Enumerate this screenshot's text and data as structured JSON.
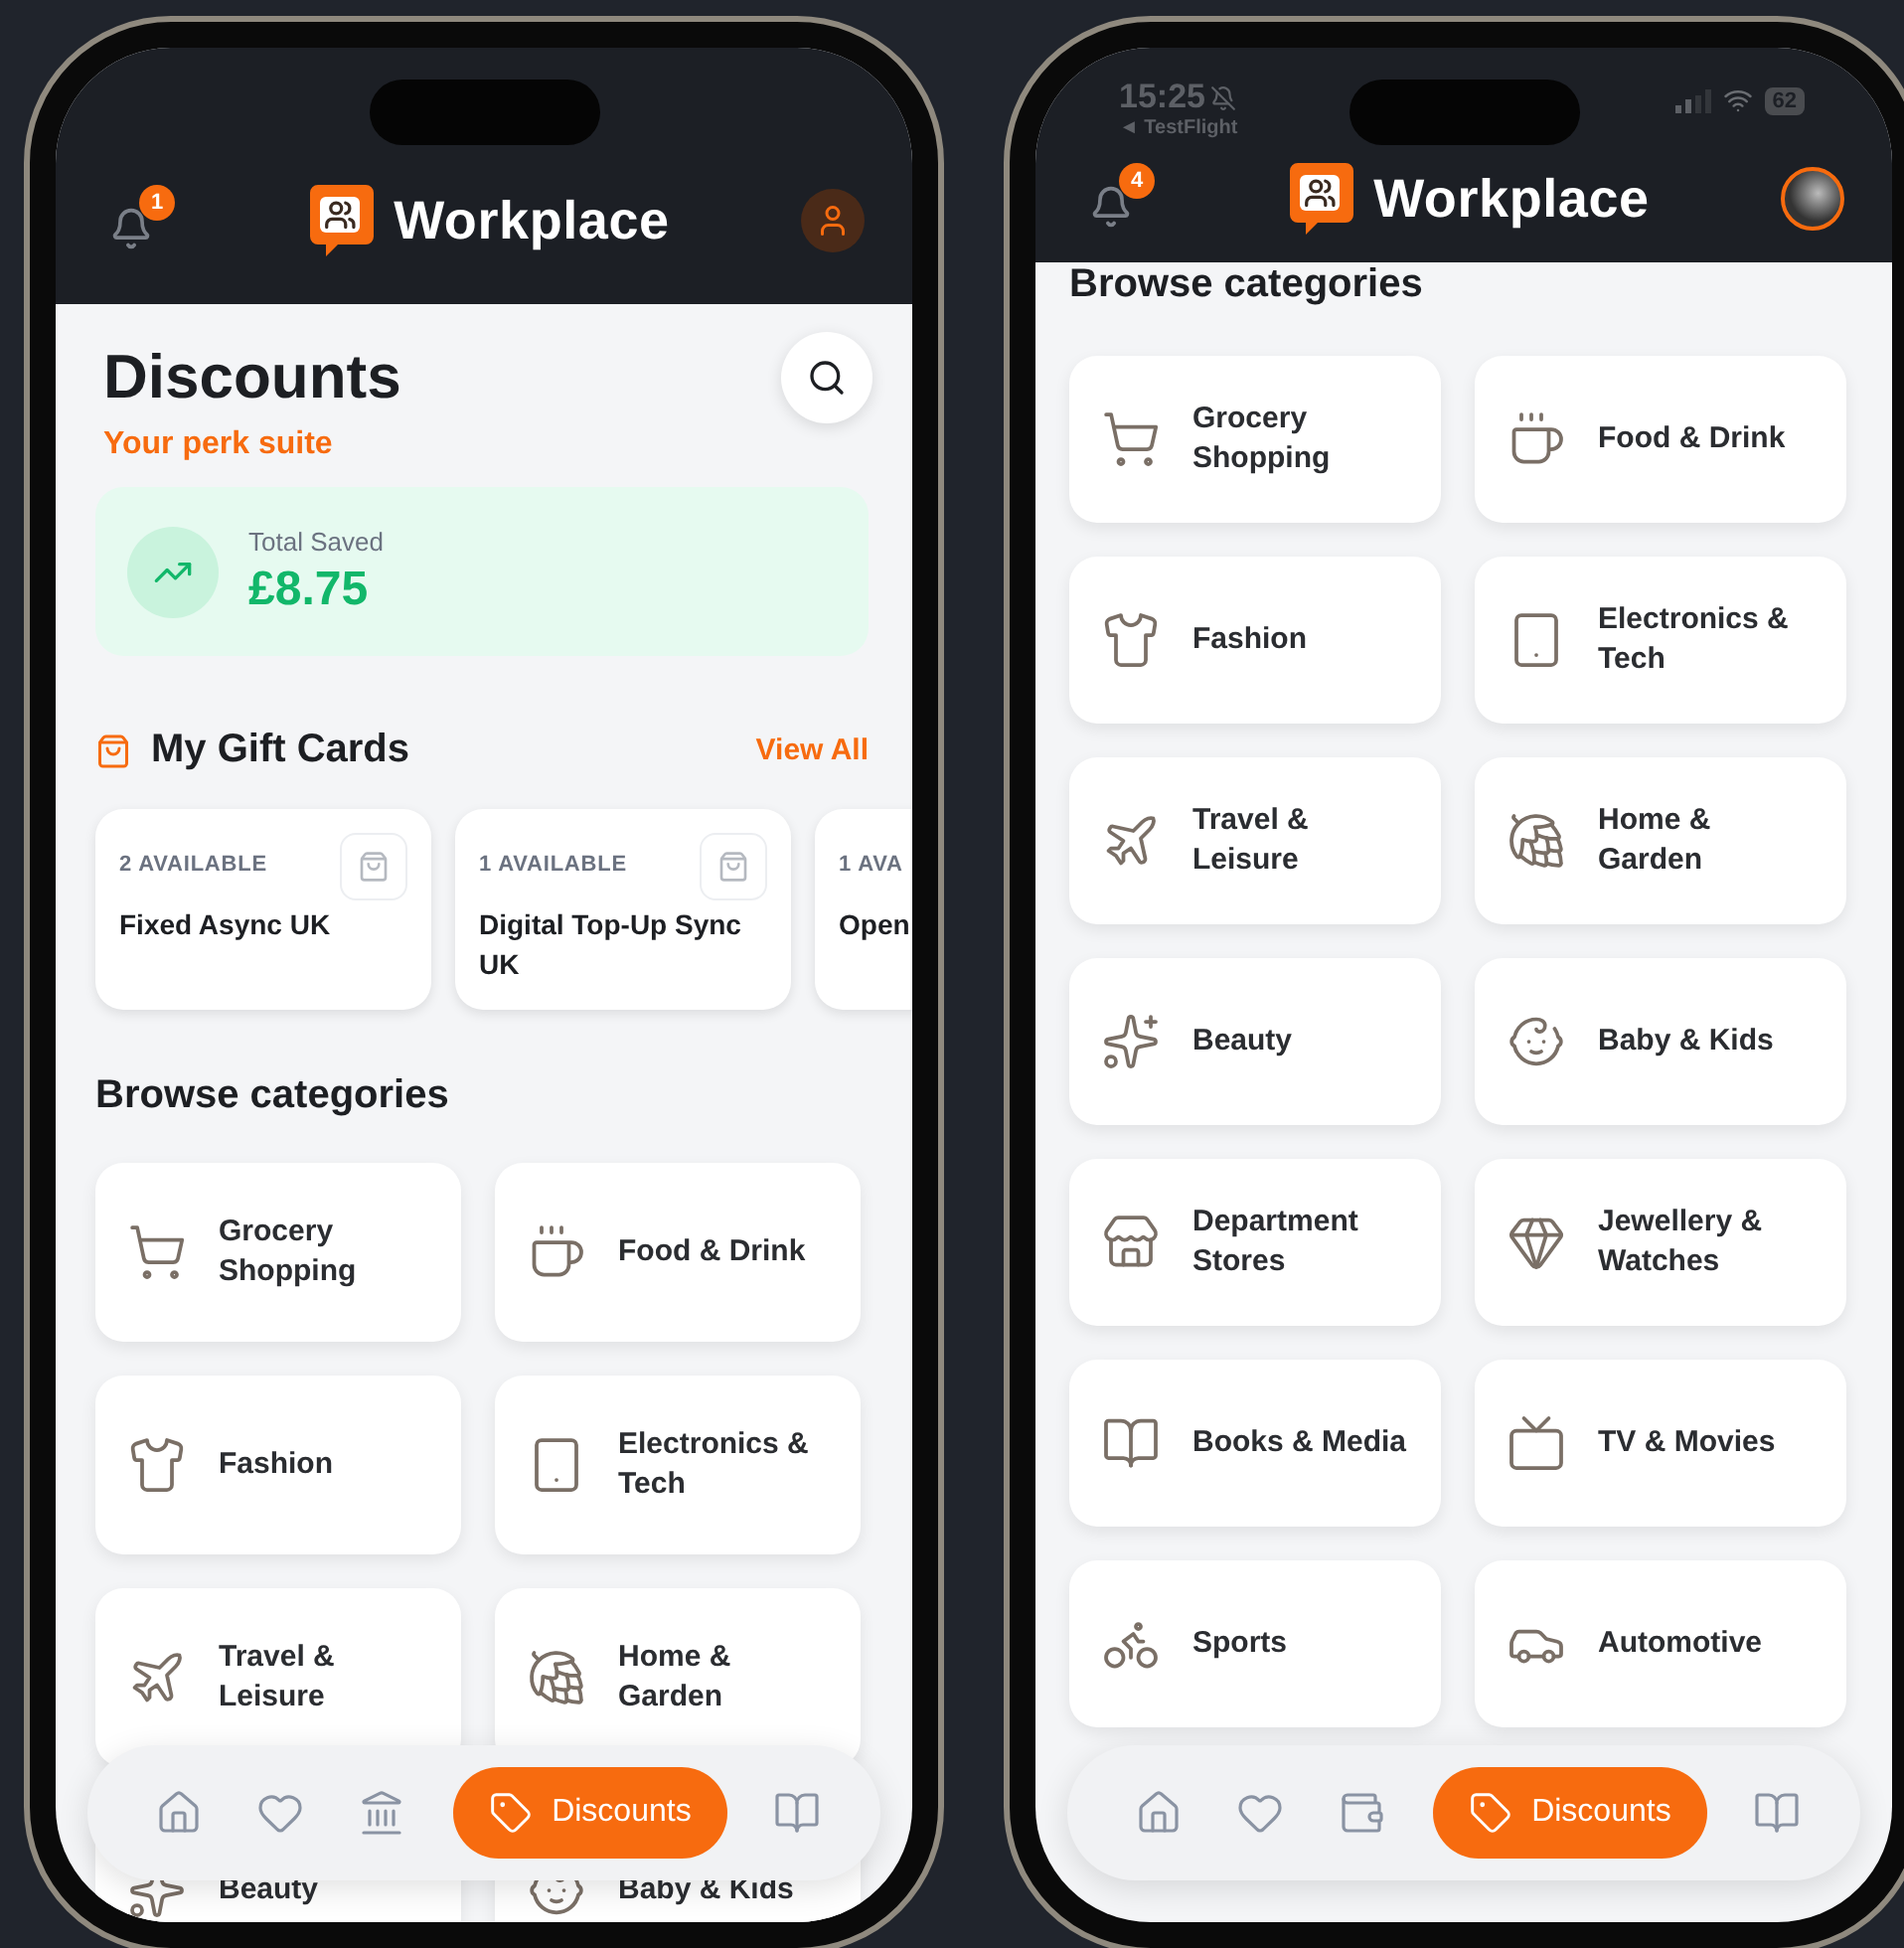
{
  "phones": [
    {
      "header": {
        "notifications": "1",
        "brand": "Workplace",
        "avatar": {
          "photo": false
        }
      },
      "title": "Discounts",
      "subtitle": "Your perk suite",
      "savings": {
        "label": "Total Saved",
        "amount": "£8.75"
      },
      "gift_cards": {
        "title": "My Gift Cards",
        "link": "View All",
        "items": [
          {
            "availability": "2 AVAILABLE",
            "name": "Fixed Async UK"
          },
          {
            "availability": "1 AVAILABLE",
            "name": "Digital Top-Up Sync UK"
          },
          {
            "availability": "1 AVA",
            "name": "Open"
          }
        ]
      },
      "categories_title": "Browse categories",
      "category_rows": [
        [
          "Grocery Shopping",
          "Food & Drink"
        ],
        [
          "Fashion",
          "Electronics & Tech"
        ],
        [
          "Travel & Leisure",
          "Home & Garden"
        ],
        [
          "Beauty",
          "Baby & Kids"
        ]
      ],
      "nav": [
        {
          "kind": "home",
          "selected": false
        },
        {
          "kind": "favourites",
          "selected": false
        },
        {
          "kind": "bank",
          "selected": false
        },
        {
          "kind": "discounts",
          "selected": true,
          "label": "Discounts"
        },
        {
          "kind": "guide",
          "selected": false
        }
      ]
    },
    {
      "status_bar": {
        "time": "15:25",
        "back": "◄ TestFlight",
        "battery": "62"
      },
      "header": {
        "notifications": "4",
        "brand": "Workplace",
        "avatar": {
          "photo": true
        }
      },
      "categories_title": "Browse categories",
      "category_rows": [
        [
          "Grocery Shopping",
          "Food & Drink"
        ],
        [
          "Fashion",
          "Electronics & Tech"
        ],
        [
          "Travel & Leisure",
          "Home & Garden"
        ],
        [
          "Beauty",
          "Baby & Kids"
        ],
        [
          "Department Stores",
          "Jewellery & Watches"
        ],
        [
          "Books & Media",
          "TV & Movies"
        ],
        [
          "Sports",
          "Automotive"
        ]
      ],
      "nav": [
        {
          "kind": "home",
          "selected": false
        },
        {
          "kind": "favourites",
          "selected": false
        },
        {
          "kind": "wallet",
          "selected": false
        },
        {
          "kind": "discounts",
          "selected": true,
          "label": "Discounts"
        },
        {
          "kind": "guide",
          "selected": false
        }
      ]
    }
  ]
}
